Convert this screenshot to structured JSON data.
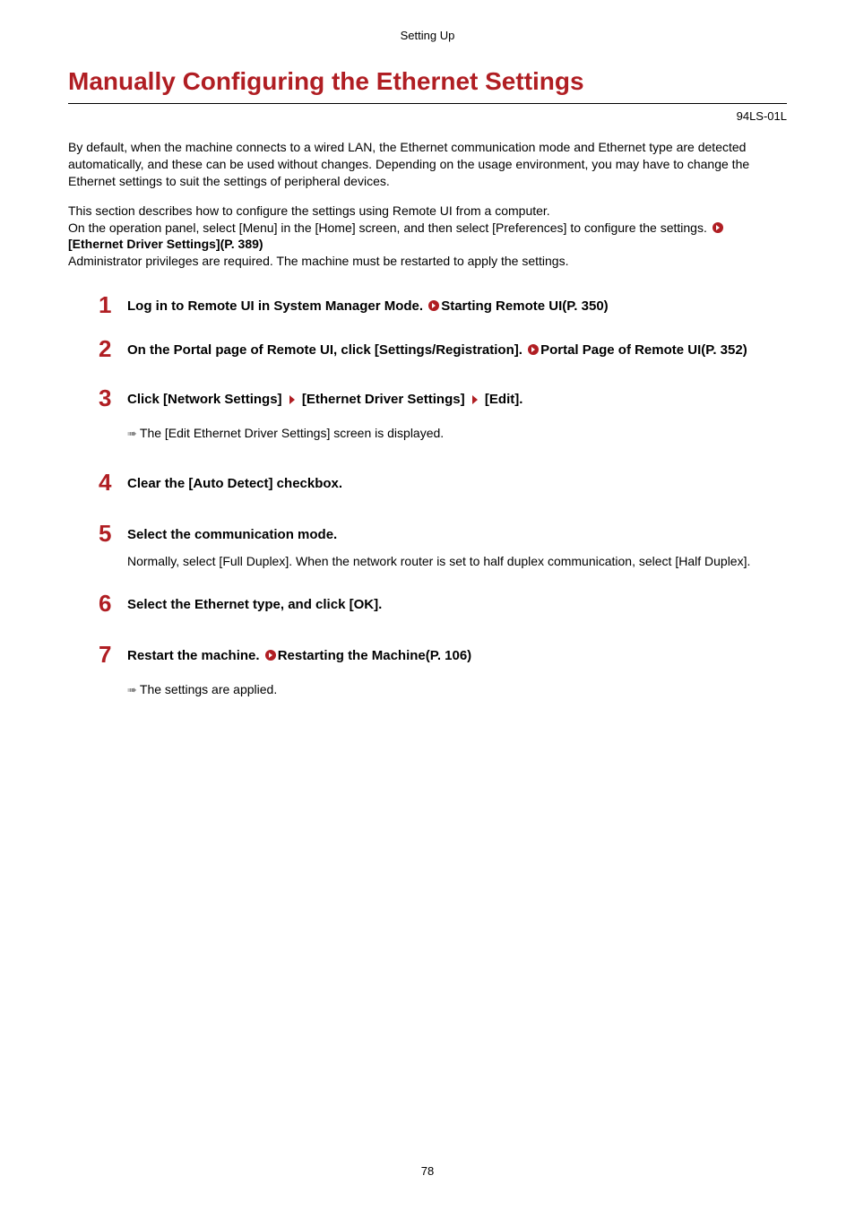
{
  "header": "Setting Up",
  "title": "Manually Configuring the Ethernet Settings",
  "docCode": "94LS-01L",
  "intro": {
    "p1": "By default, when the machine connects to a wired LAN, the Ethernet communication mode and Ethernet type are detected automatically, and these can be used without changes. Depending on the usage environment, you may have to change the Ethernet settings to suit the settings of peripheral devices.",
    "p2a": "This section describes how to configure the settings using Remote UI from a computer.",
    "p2b": "On the operation panel, select [Menu] in the [Home] screen, and then select [Preferences] to configure the settings. ",
    "p2link": "[Ethernet Driver Settings](P. 389)",
    "p2c": "Administrator privileges are required. The machine must be restarted to apply the settings."
  },
  "steps": [
    {
      "num": "1",
      "title_a": "Log in to Remote UI in System Manager Mode. ",
      "title_link": "Starting Remote UI(P. 350)"
    },
    {
      "num": "2",
      "title_a": "On the Portal page of Remote UI, click [Settings/Registration]. ",
      "title_link": "Portal Page of Remote UI(P. 352)"
    },
    {
      "num": "3",
      "title_parts": [
        "Click [Network Settings] ",
        " [Ethernet Driver Settings] ",
        " [Edit]."
      ],
      "result": "The [Edit Ethernet Driver Settings] screen is displayed."
    },
    {
      "num": "4",
      "title_a": "Clear the [Auto Detect] checkbox."
    },
    {
      "num": "5",
      "title_a": "Select the communication mode.",
      "body": "Normally, select [Full Duplex]. When the network router is set to half duplex communication, select [Half Duplex]."
    },
    {
      "num": "6",
      "title_a": "Select the Ethernet type, and click [OK]."
    },
    {
      "num": "7",
      "title_a": "Restart the machine. ",
      "title_link": "Restarting the Machine(P. 106)",
      "result": "The settings are applied."
    }
  ],
  "pageNum": "78"
}
